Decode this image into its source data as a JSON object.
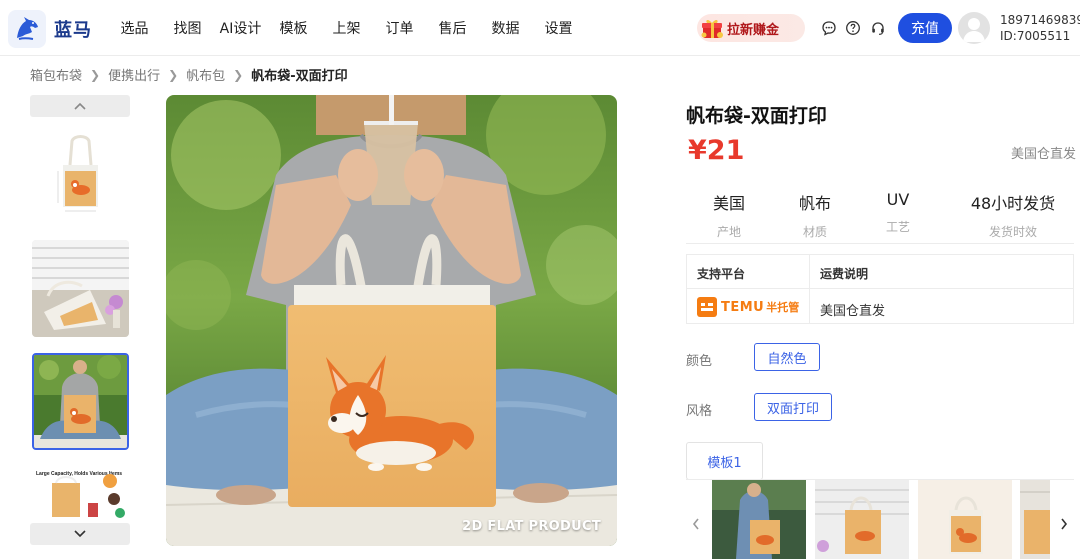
{
  "brand": {
    "name": "蓝马"
  },
  "nav": [
    "选品",
    "找图",
    "AI设计",
    "模板",
    "上架",
    "订单",
    "售后",
    "数据",
    "设置"
  ],
  "promo": {
    "label": "拉新赚金"
  },
  "header_icons": [
    "message-icon",
    "help-icon",
    "headset-icon"
  ],
  "recharge_label": "充值",
  "user": {
    "phone": "18971469839",
    "id": "ID:7005511"
  },
  "breadcrumb": [
    "箱包布袋",
    "便携出行",
    "帆布包",
    "帆布袋-双面打印"
  ],
  "gallery": {
    "main_caption": "2D FLAT PRODUCT",
    "thumb2_text": "Large Capacity, Holds Various Items"
  },
  "product": {
    "title": "帆布袋-双面打印",
    "price": "¥21",
    "shipping_tag": "美国仓直发",
    "attributes": [
      {
        "value": "美国",
        "label": "产地"
      },
      {
        "value": "帆布",
        "label": "材质"
      },
      {
        "value": "UV",
        "label": "工艺"
      },
      {
        "value": "48小时发货",
        "label": "发货时效"
      }
    ],
    "table": {
      "headers": [
        "支持平台",
        "运费说明"
      ],
      "platform_name": "TEMU",
      "platform_sub": "半托管",
      "shipping_note": "美国仓直发"
    },
    "options": [
      {
        "label": "颜色",
        "value": "自然色"
      },
      {
        "label": "风格",
        "value": "双面打印"
      }
    ],
    "template_tab": "模板1"
  },
  "colors": {
    "accent": "#3b63e6",
    "price": "#e8392c",
    "primary_button": "#1f4fe0",
    "temu": "#f57c12"
  }
}
